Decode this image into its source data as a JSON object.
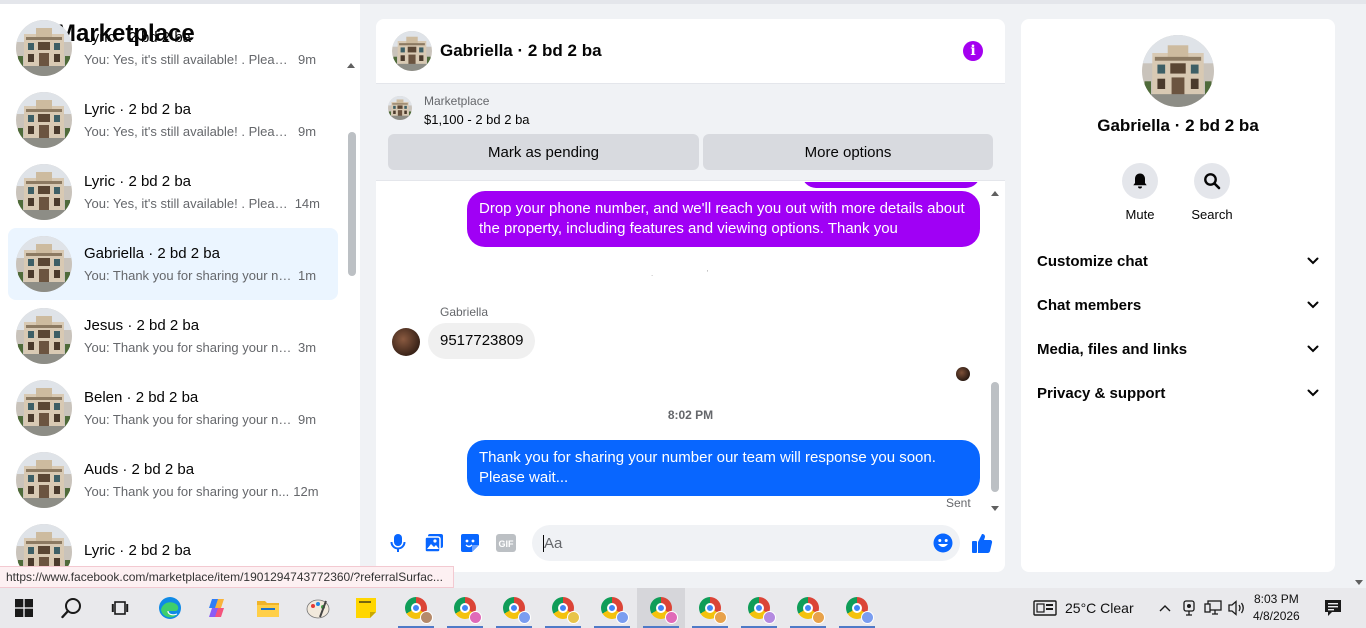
{
  "left_panel": {
    "title": "Marketplace",
    "conversations": [
      {
        "name": "Lyric · 2 bd 2 ba",
        "snippet": "You: Yes, it's still available! . Please ...",
        "time": "9m"
      },
      {
        "name": "Lyric · 2 bd 2 ba",
        "snippet": "You: Yes, it's still available! . Please ...",
        "time": "9m"
      },
      {
        "name": "Lyric · 2 bd 2 ba",
        "snippet": "You: Yes, it's still available! . Pleas...",
        "time": "14m"
      },
      {
        "name": "Gabriella · 2 bd 2 ba",
        "snippet": "You: Thank you for sharing your nu...",
        "time": "1m"
      },
      {
        "name": "Jesus · 2 bd 2 ba",
        "snippet": "You: Thank you for sharing your nu...",
        "time": "3m"
      },
      {
        "name": "Belen · 2 bd 2 ba",
        "snippet": "You: Thank you for sharing your nu...",
        "time": "9m"
      },
      {
        "name": "Auds · 2 bd 2 ba",
        "snippet": "You: Thank you for sharing your n...",
        "time": "12m"
      },
      {
        "name": "Lyric · 2 bd 2 ba",
        "snippet": "",
        "time": ""
      }
    ],
    "active_index": 3
  },
  "status_url": "https://www.facebook.com/marketplace/item/1901294743772360/?referralSurfac...",
  "chat": {
    "header_title": "Gabriella · 2 bd 2 ba",
    "marketplace_label": "Marketplace",
    "listing": "$1,100 - 2 bd 2 ba",
    "mark_pending_label": "Mark as pending",
    "more_options_label": "More options",
    "messages": {
      "purple_text": "Drop your phone number, and we'll reach you out with more details about the property, including features and viewing options.  Thank you",
      "sender_name": "Gabriella",
      "received_text": "9517723809",
      "timestamp": "8:02 PM",
      "blue_text": "Thank you for sharing your number our team will response you soon. Please wait...",
      "sent_status": "Sent"
    },
    "composer_placeholder": "Aa",
    "gif_label": "GIF"
  },
  "right_panel": {
    "name": "Gabriella · 2 bd 2 ba",
    "mute_label": "Mute",
    "search_label": "Search",
    "sections": [
      "Customize chat",
      "Chat members",
      "Media, files and links",
      "Privacy & support"
    ]
  },
  "taskbar": {
    "weather": "25°C  Clear",
    "time": "8:03 PM",
    "date": "4/8/2026"
  },
  "colors": {
    "purple_bubble": "#a000f5",
    "blue_bubble": "#0866ff",
    "accent_blue": "#0866ff",
    "info_purple": "#a400f0",
    "active_conv": "#ebf5ff"
  }
}
